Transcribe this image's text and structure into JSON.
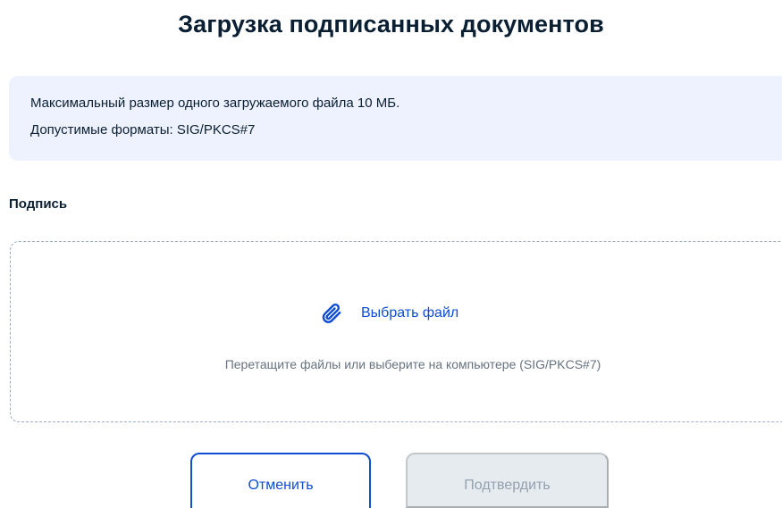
{
  "page": {
    "title": "Загрузка подписанных документов"
  },
  "info": {
    "max_size": "Максимальный размер одного загружаемого файла 10 МБ.",
    "formats": "Допустимые форматы: SIG/PKCS#7"
  },
  "signature_section": {
    "label": "Подпись"
  },
  "dropzone": {
    "pick_file_label": "Выбрать файл",
    "pick_file_icon": "paperclip-icon",
    "hint": "Перетащите файлы или выберите на компьютере (SIG/PKCS#7)"
  },
  "actions": {
    "cancel_label": "Отменить",
    "confirm_label": "Подтвердить"
  },
  "colors": {
    "accent": "#0d4cd3",
    "info_background": "#edf2fe",
    "dropzone_border": "#99aec4",
    "disabled_button_background": "#e6ebef",
    "disabled_button_text": "#94a0ad",
    "hint_text": "#66727f"
  }
}
